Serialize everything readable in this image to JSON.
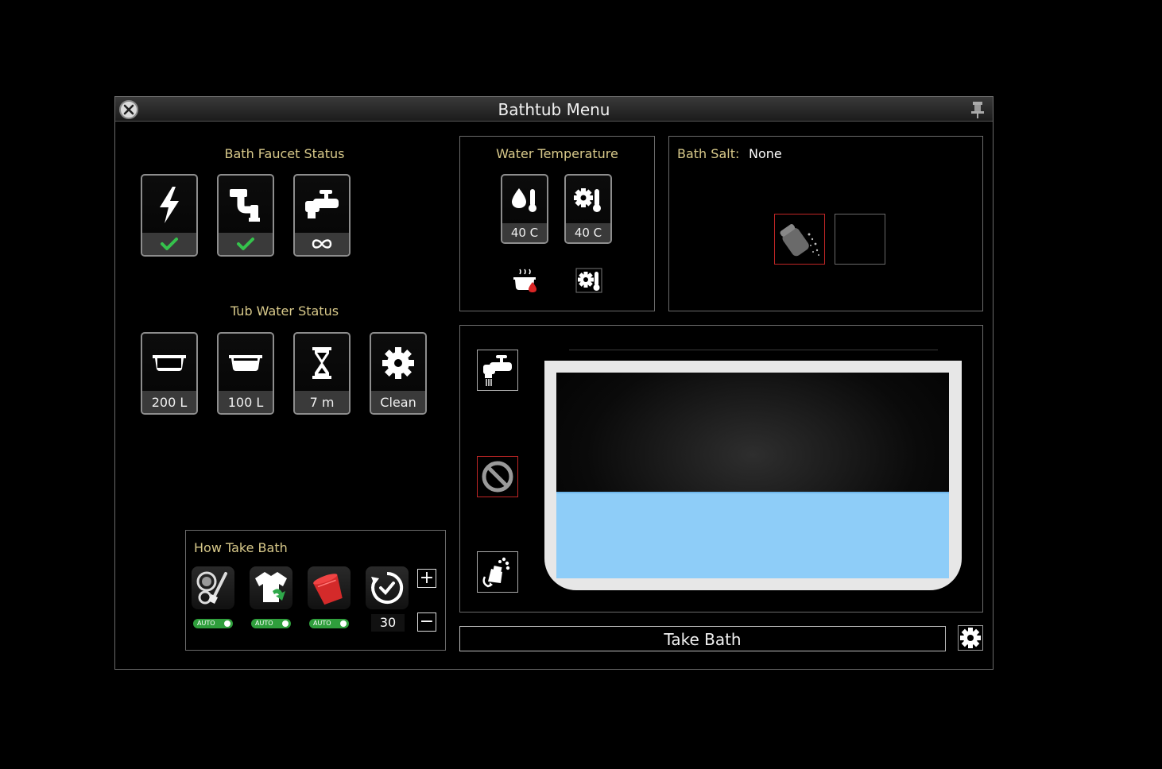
{
  "window": {
    "title": "Bathtub Menu"
  },
  "faucet": {
    "heading": "Bath Faucet Status",
    "items": [
      {
        "icon": "power-icon",
        "status_icon": "check-icon"
      },
      {
        "icon": "pipe-icon",
        "status_icon": "check-icon"
      },
      {
        "icon": "faucet-icon",
        "status_icon": "infinity-icon"
      }
    ]
  },
  "tub": {
    "heading": "Tub Water Status",
    "items": [
      {
        "icon": "empty-tub-icon",
        "value": "200 L"
      },
      {
        "icon": "full-tub-icon",
        "value": "100 L"
      },
      {
        "icon": "hourglass-icon",
        "value": "7 m"
      },
      {
        "icon": "gear-icon",
        "value": "Clean"
      }
    ]
  },
  "temperature": {
    "heading": "Water Temperature",
    "current": "40 C",
    "target": "40 C"
  },
  "bath_salt": {
    "label": "Bath Salt:",
    "value": "None"
  },
  "how": {
    "heading": "How Take Bath",
    "auto_label": "AUTO",
    "duration": "30",
    "plus": "+",
    "minus": "−"
  },
  "water_level": 0.42,
  "colors": {
    "accent": "#d8c98a",
    "water": "#8ecdf8",
    "auto_green": "#2f9e3c",
    "alert_red": "#c02626"
  },
  "take_bath_label": "Take Bath"
}
